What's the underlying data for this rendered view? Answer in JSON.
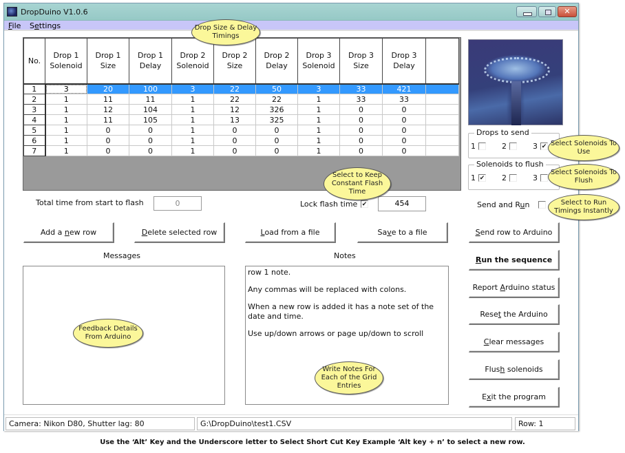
{
  "window": {
    "title": "DropDuino V1.0.6",
    "controls": [
      "minimize",
      "maximize",
      "close"
    ]
  },
  "menu": [
    {
      "label": "File",
      "mnemonic": "F"
    },
    {
      "label": "Settings",
      "mnemonic": "e"
    }
  ],
  "grid": {
    "headers": [
      "No.",
      "Drop 1 Solenoid",
      "Drop 1 Size",
      "Drop 1 Delay",
      "Drop 2 Solenoid",
      "Drop 2 Size",
      "Drop 2 Delay",
      "Drop 3 Solenoid",
      "Drop 3 Size",
      "Drop 3 Delay",
      ""
    ],
    "selected_row": 1,
    "rows": [
      [
        "1",
        "3",
        "20",
        "100",
        "3",
        "22",
        "50",
        "3",
        "33",
        "421",
        ""
      ],
      [
        "2",
        "1",
        "11",
        "11",
        "1",
        "22",
        "22",
        "1",
        "33",
        "33",
        ""
      ],
      [
        "3",
        "1",
        "12",
        "104",
        "1",
        "12",
        "326",
        "1",
        "0",
        "0",
        ""
      ],
      [
        "4",
        "1",
        "11",
        "105",
        "1",
        "13",
        "325",
        "1",
        "0",
        "0",
        ""
      ],
      [
        "5",
        "1",
        "0",
        "0",
        "1",
        "0",
        "0",
        "1",
        "0",
        "0",
        ""
      ],
      [
        "6",
        "1",
        "0",
        "0",
        "1",
        "0",
        "0",
        "1",
        "0",
        "0",
        ""
      ],
      [
        "7",
        "1",
        "0",
        "0",
        "1",
        "0",
        "0",
        "1",
        "0",
        "0",
        ""
      ]
    ]
  },
  "timing": {
    "total_label": "Total time from start to flash",
    "total_value": "0",
    "lock_label": "Lock flash time",
    "lock_checked": true,
    "lock_value": "454"
  },
  "buttons": {
    "add_row": {
      "pre": "Add a ",
      "key": "n",
      "post": "ew row"
    },
    "delete_row": {
      "pre": "",
      "key": "D",
      "post": "elete selected row"
    },
    "load_file": {
      "pre": "",
      "key": "L",
      "post": "oad from a file"
    },
    "save_file": {
      "pre": "Sa",
      "key": "v",
      "post": "e to a file"
    },
    "send_row": {
      "pre": "",
      "key": "S",
      "post": "end row to Arduino"
    },
    "run_sequence": {
      "pre": "",
      "key": "R",
      "post": "un the sequence"
    },
    "report_status": {
      "pre": "Report ",
      "key": "A",
      "post": "rduino status"
    },
    "reset_arduino": {
      "pre": "Rese",
      "key": "t",
      "post": " the Arduino"
    },
    "clear_messages": {
      "pre": "",
      "key": "C",
      "post": "lear messages"
    },
    "flush_solenoids": {
      "pre": "Flus",
      "key": "h",
      "post": " solenoids"
    },
    "exit_program": {
      "pre": "E",
      "key": "x",
      "post": "it the program"
    }
  },
  "messages": {
    "label": "Messages",
    "content": ""
  },
  "notes": {
    "label": "Notes",
    "paragraphs": [
      "row 1 note.",
      "Any commas will be replaced with colons.",
      "When a new row is added it has a note set of the date and time.",
      "Use up/down arrows or page up/down to scroll"
    ]
  },
  "drops_to_send": {
    "label": "Drops to send",
    "options": [
      {
        "label": "1",
        "checked": false
      },
      {
        "label": "2",
        "checked": false
      },
      {
        "label": "3",
        "checked": true
      }
    ]
  },
  "solenoids_to_flush": {
    "label": "Solenoids to flush",
    "options": [
      {
        "label": "1",
        "checked": true
      },
      {
        "label": "2",
        "checked": false
      },
      {
        "label": "3",
        "checked": false
      }
    ]
  },
  "send_and_run": {
    "pre": "Send and R",
    "key": "u",
    "post": "n",
    "checked": false
  },
  "status_bar": {
    "camera": "Camera: Nikon D80, Shutter lag: 80",
    "file_path": "G:\\DropDuino\\test1.CSV",
    "row": "Row: 1"
  },
  "callouts": {
    "grid": "Drop Size & Delay Timings",
    "lock": "Select to Keep Constant Flash Time",
    "drops": "Select Solenoids To Use",
    "flush": "Select Solenoids To Flush",
    "run": "Select to Run Timings Instantly",
    "messages": "Feedback Details From Arduino",
    "notes": "Write Notes For Each of the Grid Entries"
  },
  "footer_note": "Use the  ‘Alt’  Key and the Underscore letter to Select Short Cut Key Example ‘Alt key + n’ to select a new row.",
  "colors": {
    "selection": "#3399ff",
    "titlebar": "#9fcfcc",
    "menubar": "#c8c6f8",
    "callout": "#fbf79a"
  }
}
